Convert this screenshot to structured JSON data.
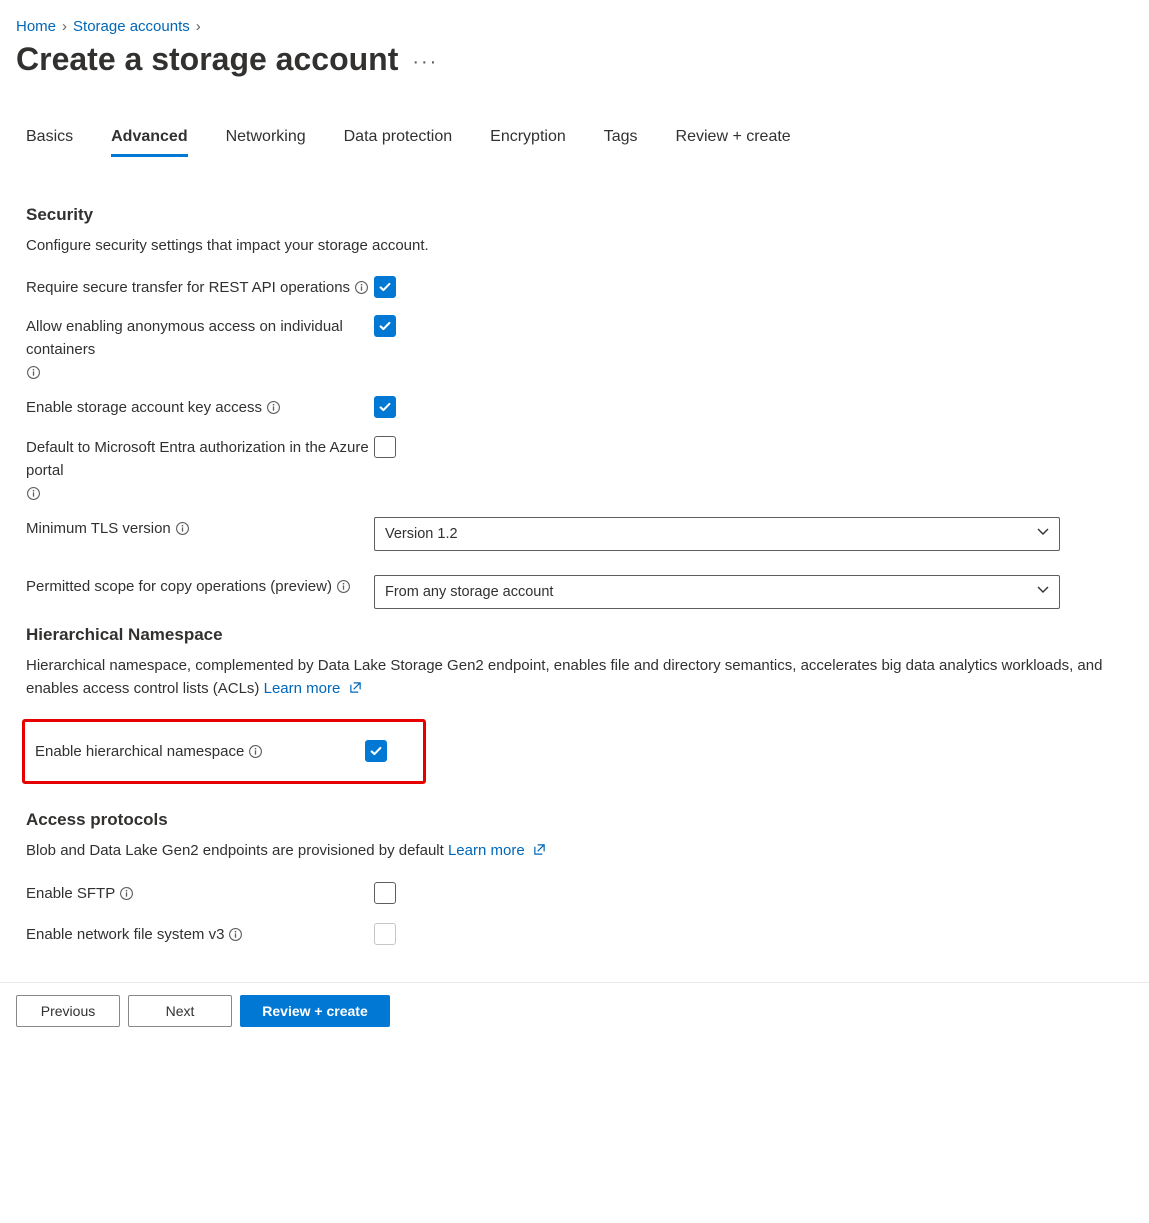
{
  "breadcrumb": [
    {
      "label": "Home"
    },
    {
      "label": "Storage accounts"
    }
  ],
  "pageTitle": "Create a storage account",
  "tabs": [
    {
      "label": "Basics",
      "active": false
    },
    {
      "label": "Advanced",
      "active": true
    },
    {
      "label": "Networking",
      "active": false
    },
    {
      "label": "Data protection",
      "active": false
    },
    {
      "label": "Encryption",
      "active": false
    },
    {
      "label": "Tags",
      "active": false
    },
    {
      "label": "Review + create",
      "active": false
    }
  ],
  "sections": {
    "security": {
      "title": "Security",
      "desc": "Configure security settings that impact your storage account.",
      "fields": {
        "secureTransfer": {
          "label": "Require secure transfer for REST API operations",
          "checked": true
        },
        "anonAccess": {
          "label": "Allow enabling anonymous access on individual containers",
          "checked": true
        },
        "keyAccess": {
          "label": "Enable storage account key access",
          "checked": true
        },
        "entraAuth": {
          "label": "Default to Microsoft Entra authorization in the Azure portal",
          "checked": false
        },
        "minTls": {
          "label": "Minimum TLS version",
          "value": "Version 1.2"
        },
        "copyScope": {
          "label": "Permitted scope for copy operations (preview)",
          "value": "From any storage account"
        }
      }
    },
    "hns": {
      "title": "Hierarchical Namespace",
      "desc": "Hierarchical namespace, complemented by Data Lake Storage Gen2 endpoint, enables file and directory semantics, accelerates big data analytics workloads, and enables access control lists (ACLs)",
      "learnMore": "Learn more",
      "field": {
        "label": "Enable hierarchical namespace",
        "checked": true
      }
    },
    "protocols": {
      "title": "Access protocols",
      "desc": "Blob and Data Lake Gen2 endpoints are provisioned by default",
      "learnMore": "Learn more",
      "fields": {
        "sftp": {
          "label": "Enable SFTP",
          "checked": false
        },
        "nfs3": {
          "label": "Enable network file system v3",
          "checked": false,
          "disabled": true
        }
      }
    }
  },
  "footer": {
    "previous": "Previous",
    "next": "Next",
    "review": "Review + create"
  }
}
